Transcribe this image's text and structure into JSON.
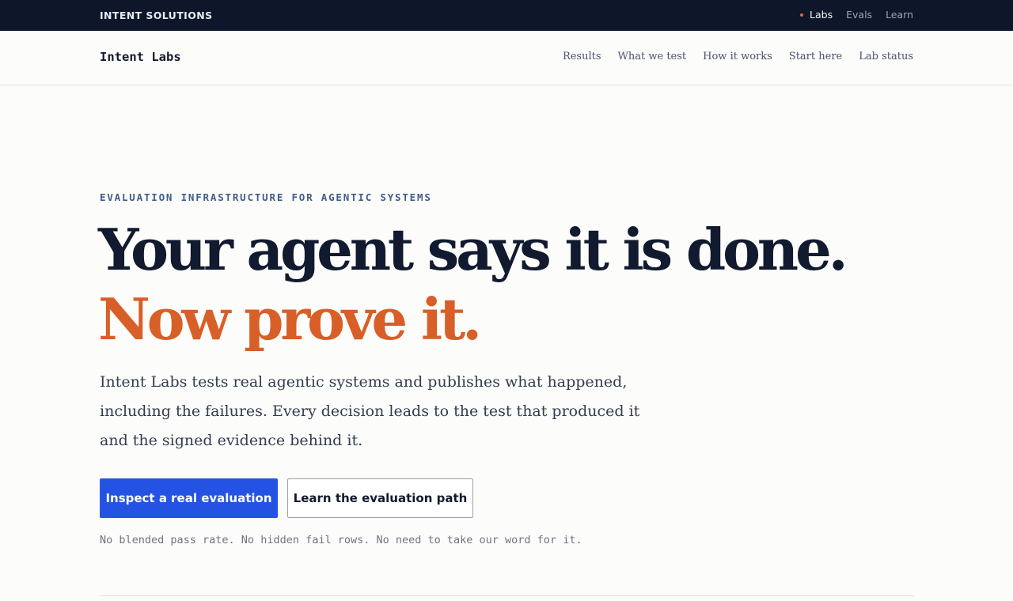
{
  "topbar": {
    "brand": "INTENT SOLUTIONS",
    "links": [
      {
        "label": "Labs",
        "active": true
      },
      {
        "label": "Evals",
        "active": false
      },
      {
        "label": "Learn",
        "active": false
      }
    ]
  },
  "navbar": {
    "logo": "Intent Labs",
    "menu": [
      "Results",
      "What we test",
      "How it works",
      "Start here",
      "Lab status"
    ]
  },
  "hero": {
    "eyebrow": "EVALUATION INFRASTRUCTURE FOR AGENTIC SYSTEMS",
    "headline_line1": "Your agent says it is done.",
    "headline_line2": "Now prove it.",
    "lede": "Intent Labs tests real agentic systems and publishes what happened, including the failures. Every decision leads to the test that produced it and the signed evidence behind it.",
    "primary_cta": "Inspect a real evaluation",
    "secondary_cta": "Learn the evaluation path",
    "note": "No blended pass rate. No hidden fail rows. No need to take our word for it."
  },
  "colors": {
    "topbar_bg": "#0e1729",
    "accent_orange": "#d85f27",
    "primary_blue": "#2453e4",
    "headline_navy": "#111a2e"
  }
}
